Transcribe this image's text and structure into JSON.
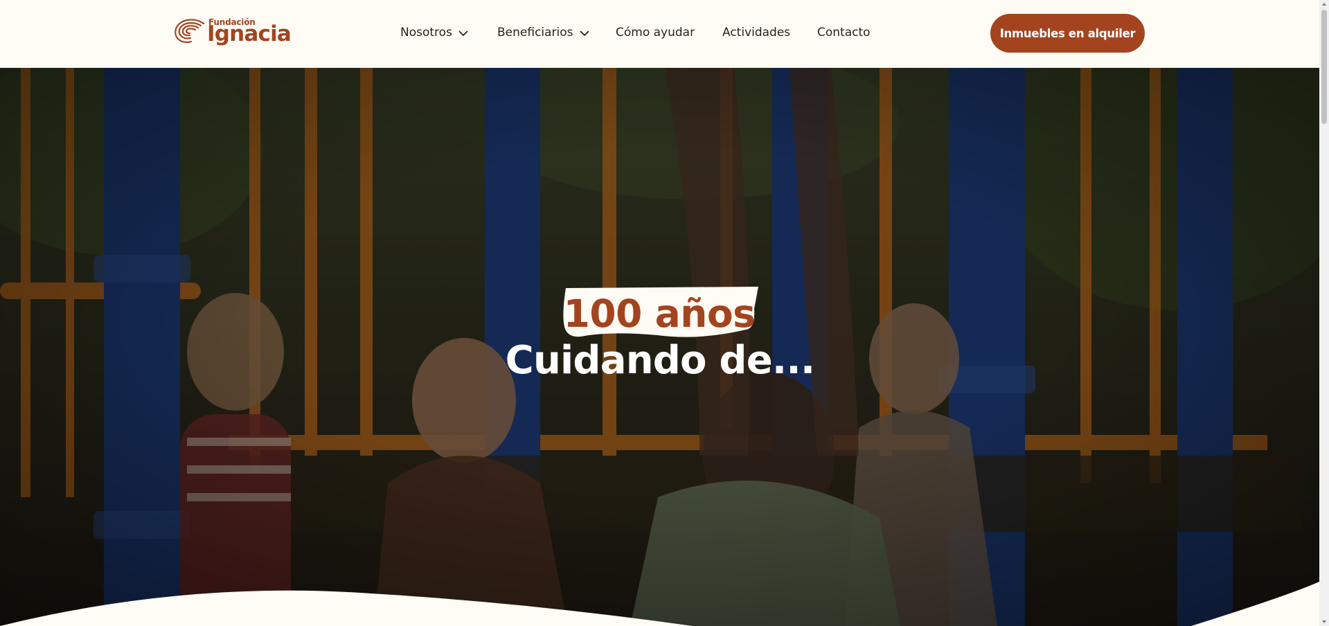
{
  "brand": {
    "small": "Fundación",
    "name": "Ignacia",
    "color": "#a4441f"
  },
  "nav": {
    "items": [
      {
        "label": "Nosotros",
        "has_dropdown": true
      },
      {
        "label": "Beneficiarios",
        "has_dropdown": true
      },
      {
        "label": "Cómo ayudar",
        "has_dropdown": false
      },
      {
        "label": "Actividades",
        "has_dropdown": false
      },
      {
        "label": "Contacto",
        "has_dropdown": false
      }
    ],
    "icons": [
      "chevron-down-icon"
    ]
  },
  "cta": {
    "label": "Inmuebles en alquiler"
  },
  "hero": {
    "badge": "100 años",
    "subtitle": "Cuidando de..."
  },
  "colors": {
    "background": "#fefcf5",
    "accent": "#a4441f",
    "text": "#2a211c"
  }
}
